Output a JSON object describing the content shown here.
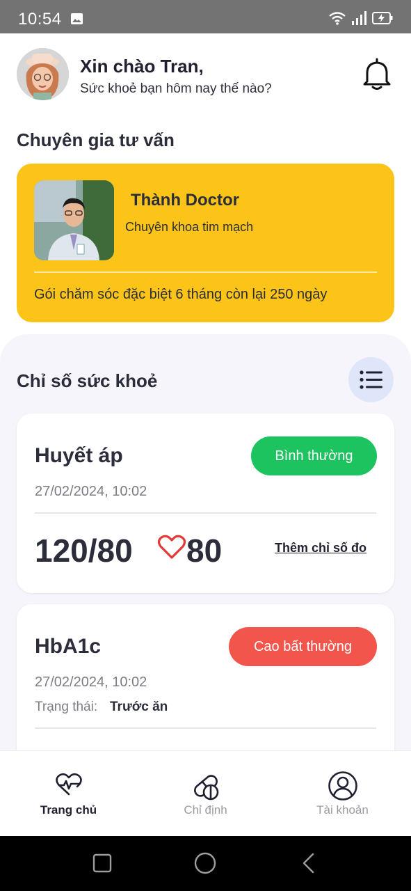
{
  "status_bar": {
    "time": "10:54",
    "icons": [
      "image-icon",
      "wifi-icon",
      "signal-icon",
      "battery-charging-icon"
    ]
  },
  "header": {
    "greeting": "Xin chào Tran,",
    "subtitle": "Sức khoẻ bạn hôm nay thế nào?",
    "notification_icon": "bell-icon"
  },
  "expert_section": {
    "title": "Chuyên gia tư vấn",
    "doctor_name": "Thành Doctor",
    "specialty": "Chuyên khoa tim mạch",
    "package": "Gói chăm sóc đặc biệt 6 tháng còn lại 250 ngày"
  },
  "health_section": {
    "title": "Chỉ số sức khoẻ",
    "list_icon": "list-icon",
    "cards": [
      {
        "name": "Huyết áp",
        "badge": "Bình thường",
        "date": "27/02/2024, 10:02",
        "value": "120/80",
        "pulse": "80",
        "add_link": "Thêm chỉ số đo"
      },
      {
        "name": "HbA1c",
        "badge": "Cao bất thường",
        "date": "27/02/2024, 10:02",
        "status_label": "Trạng thái:",
        "status_value": "Trước ăn"
      }
    ]
  },
  "bottom_nav": {
    "items": [
      {
        "label": "Trang chủ",
        "icon": "heart-pulse-icon",
        "active": true
      },
      {
        "label": "Chỉ định",
        "icon": "pills-icon",
        "active": false
      },
      {
        "label": "Tài khoản",
        "icon": "user-icon",
        "active": false
      }
    ]
  },
  "colors": {
    "accent_yellow": "#fcc419",
    "normal_green": "#1dc35f",
    "high_red": "#f2554c",
    "heart_red": "#e53935"
  }
}
